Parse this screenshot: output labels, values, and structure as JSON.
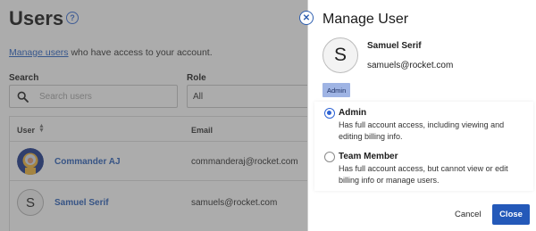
{
  "page": {
    "title": "Users",
    "help_icon_glyph": "?",
    "intro_link": "Manage users",
    "intro_rest": " who have access to your account.",
    "search_label": "Search",
    "search_placeholder": "Search users",
    "role_label": "Role",
    "role_value": "All",
    "columns": {
      "user": "User",
      "email": "Email"
    },
    "rows": [
      {
        "name": "Commander AJ",
        "email": "commanderaj@rocket.com",
        "avatar": "photo"
      },
      {
        "name": "Samuel Serif",
        "email": "samuels@rocket.com",
        "avatar": "S"
      }
    ]
  },
  "drawer": {
    "title": "Manage User",
    "avatar_letter": "S",
    "user_name": "Samuel Serif",
    "user_email": "samuels@rocket.com",
    "role_badge": "Admin",
    "options": [
      {
        "title": "Admin",
        "description": "Has full account access, including viewing and editing billing info.",
        "selected": true
      },
      {
        "title": "Team Member",
        "description": "Has full account access, but cannot view or edit billing info or manage users.",
        "selected": false
      }
    ],
    "cancel_label": "Cancel",
    "close_label": "Close",
    "close_x_glyph": "✕"
  },
  "colors": {
    "accent": "#2459b9",
    "link": "#2a5fb8",
    "badge": "#9fb4e4",
    "overlay": "rgba(70,70,70,0.45)"
  },
  "icons": {
    "help": "help-icon",
    "search": "search-icon",
    "sort": "sort-icon",
    "close": "close-icon"
  }
}
